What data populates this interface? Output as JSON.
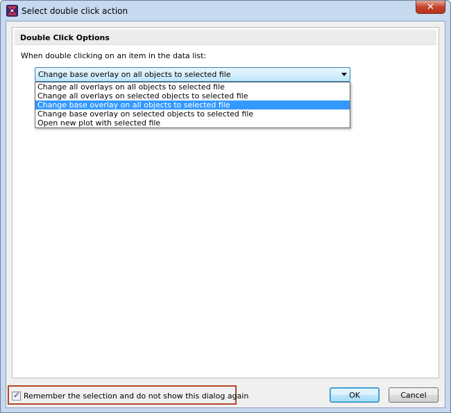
{
  "window": {
    "title": "Select double click action",
    "close_label": "✕"
  },
  "group": {
    "title": "Double Click Options",
    "prompt": "When double clicking on an item in the data list:"
  },
  "combo": {
    "selected_value": "Change base overlay on all objects to selected file",
    "options": [
      "Change all overlays on all objects to selected file",
      "Change all overlays on selected objects to selected file",
      "Change base overlay on all objects to selected file",
      "Change base overlay on selected objects to selected file",
      "Open new plot with selected file"
    ],
    "highlighted_index": 2
  },
  "remember": {
    "label": "Remember the selection and do not show this dialog again",
    "checked": true
  },
  "buttons": {
    "ok": "OK",
    "cancel": "Cancel"
  },
  "colors": {
    "highlight": "#3399ff",
    "callout_border": "#b5462b"
  },
  "icons": {
    "app": "app-logo-icon",
    "close": "close-icon",
    "dropdown": "chevron-down-icon",
    "check": "checkmark-icon"
  }
}
